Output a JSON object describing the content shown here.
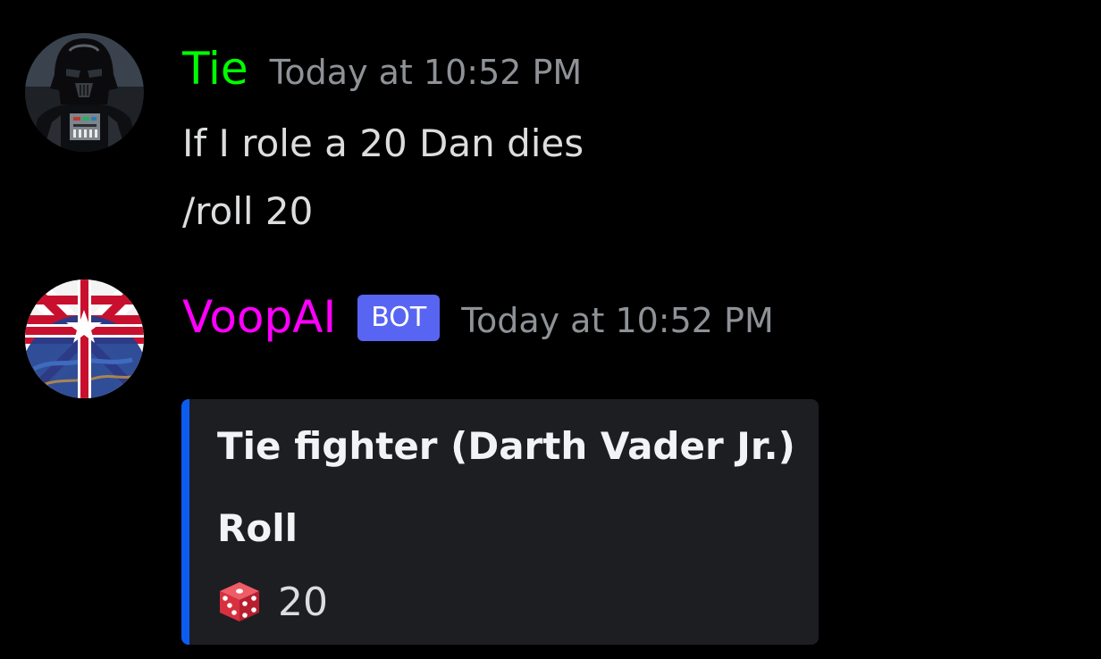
{
  "messages": [
    {
      "username": "Tie",
      "username_color": "#00ff00",
      "timestamp": "Today at 10:52 PM",
      "lines": [
        "If I role a 20 Dan dies",
        "/roll 20"
      ],
      "avatar_icon": "darth-vader-avatar"
    },
    {
      "username": "VoopAI",
      "username_color": "#ff00ff",
      "badge": "BOT",
      "badge_color": "#5865f2",
      "timestamp": "Today at 10:52 PM",
      "avatar_icon": "flag-globe-avatar",
      "embed": {
        "accent_color": "#0d5cf0",
        "title": "Tie fighter (Darth Vader Jr.)",
        "field_name": "Roll",
        "field_value": "20",
        "field_icon": "game-die-icon"
      }
    }
  ],
  "colors": {
    "background": "#000000",
    "timestamp": "#8e9297",
    "text": "#dcddde",
    "embed_bg": "#1d1e22"
  }
}
